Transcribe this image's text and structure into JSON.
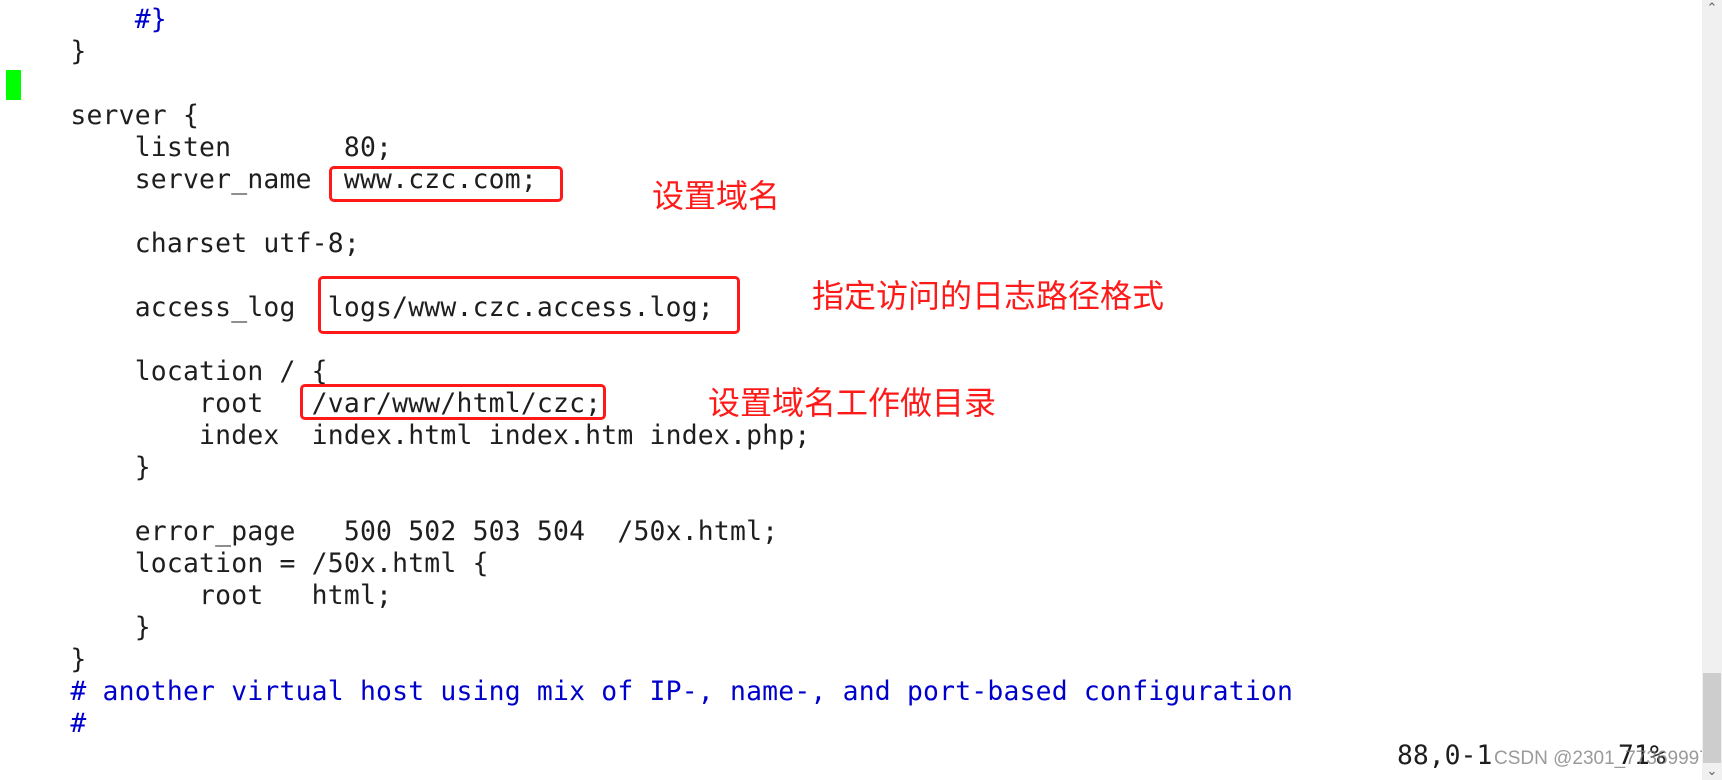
{
  "editor": {
    "lines": [
      {
        "text": "        #}",
        "type": "comment"
      },
      {
        "text": "    }",
        "type": "code"
      },
      {
        "text": "",
        "type": "code"
      },
      {
        "text": "    server {",
        "type": "code"
      },
      {
        "text": "        listen       80;",
        "type": "code"
      },
      {
        "text": "        server_name  www.czc.com;",
        "type": "code"
      },
      {
        "text": "",
        "type": "code"
      },
      {
        "text": "        charset utf-8;",
        "type": "code"
      },
      {
        "text": "",
        "type": "code"
      },
      {
        "text": "        access_log  logs/www.czc.access.log;",
        "type": "code"
      },
      {
        "text": "",
        "type": "code"
      },
      {
        "text": "        location / {",
        "type": "code"
      },
      {
        "text": "            root   /var/www/html/czc;",
        "type": "code"
      },
      {
        "text": "            index  index.html index.htm index.php;",
        "type": "code"
      },
      {
        "text": "        }",
        "type": "code"
      },
      {
        "text": "",
        "type": "code"
      },
      {
        "text": "        error_page   500 502 503 504  /50x.html;",
        "type": "code"
      },
      {
        "text": "        location = /50x.html {",
        "type": "code"
      },
      {
        "text": "            root   html;",
        "type": "code"
      },
      {
        "text": "        }",
        "type": "code"
      },
      {
        "text": "    }",
        "type": "code"
      },
      {
        "text": "    # another virtual host using mix of IP-, name-, and port-based configuration",
        "type": "comment"
      },
      {
        "text": "    #",
        "type": "comment"
      }
    ]
  },
  "status": {
    "position": "88,0-1",
    "percent": "71%"
  },
  "annotations": [
    {
      "label": "设置域名",
      "target": "www.czc.com;"
    },
    {
      "label": "指定访问的日志路径格式",
      "target": "logs/www.czc.access.log;"
    },
    {
      "label": "设置域名工作做目录",
      "target": "/var/www/html/czc;"
    }
  ],
  "watermark": "CSDN @2301_77369997",
  "scrollbar": {
    "up_icon": "chevron-up-icon",
    "down_icon": "chevron-down-icon",
    "up_glyph": "⌃",
    "down_glyph": "⌄"
  },
  "colors": {
    "comment": "#0000cc",
    "text": "#1e1e1e",
    "cursor": "#00ff00",
    "annotation": "#ff1a1a"
  }
}
